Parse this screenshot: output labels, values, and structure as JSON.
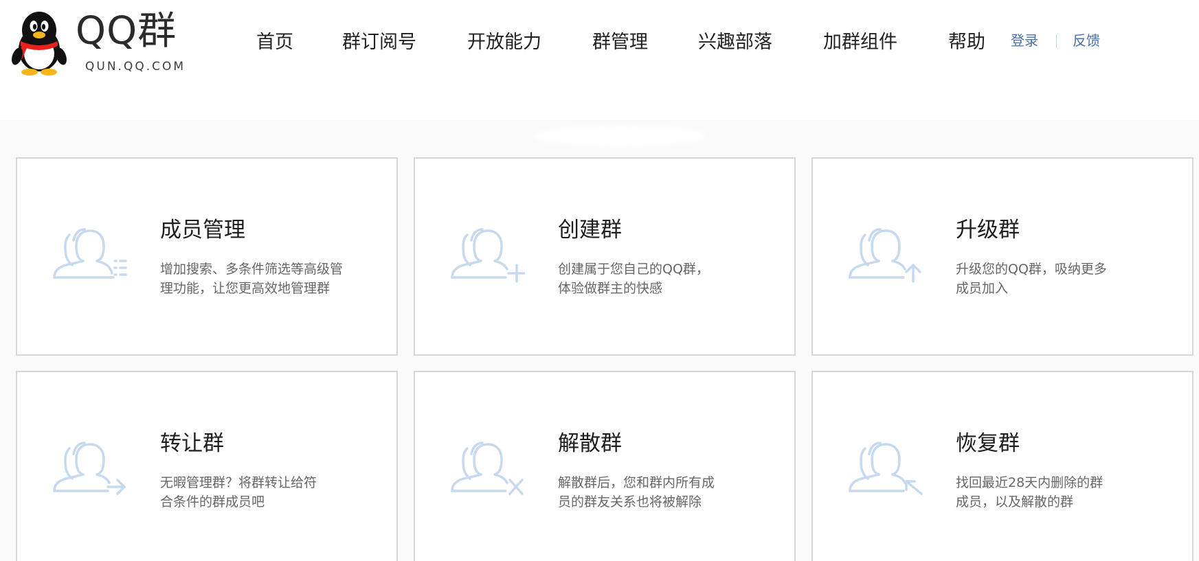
{
  "logo": {
    "title": "QQ群",
    "subtitle": "QUN.QQ.COM",
    "scarf_color": "#e8211b",
    "beak_color": "#f6b51d"
  },
  "nav": {
    "items": [
      "首页",
      "群订阅号",
      "开放能力",
      "群管理",
      "兴趣部落",
      "加群组件",
      "帮助"
    ]
  },
  "util": {
    "login": "登录",
    "separator": "|",
    "feedback": "反馈"
  },
  "colors": {
    "icon_stroke": "#c6d9ef",
    "link": "#4a6fa8",
    "card_border": "#d6d6d6"
  },
  "cards": [
    {
      "title": "成员管理",
      "desc": [
        "增加搜索、多条件筛选等高级管",
        "理功能，让您更高效地管理群"
      ],
      "icon": "members-list-icon"
    },
    {
      "title": "创建群",
      "desc": [
        "创建属于您自己的QQ群，",
        "体验做群主的快感"
      ],
      "icon": "members-add-icon"
    },
    {
      "title": "升级群",
      "desc": [
        "升级您的QQ群，吸纳更多",
        "成员加入"
      ],
      "icon": "members-upgrade-icon"
    },
    {
      "title": "转让群",
      "desc": [
        "无暇管理群？将群转让给符",
        "合条件的群成员吧"
      ],
      "icon": "members-transfer-icon"
    },
    {
      "title": "解散群",
      "desc": [
        "解散群后，您和群内所有成",
        "员的群友关系也将被解除"
      ],
      "icon": "members-dismiss-icon"
    },
    {
      "title": "恢复群",
      "desc": [
        "找回最近28天内删除的群",
        "成员，以及解散的群"
      ],
      "icon": "members-restore-icon"
    }
  ]
}
